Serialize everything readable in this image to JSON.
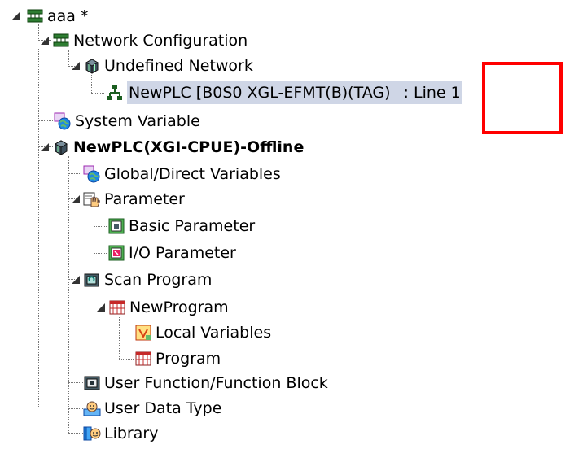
{
  "project": {
    "label": "aaa *",
    "icon": "project-network-icon"
  },
  "network_configuration": {
    "label": "Network Configuration",
    "icon": "network-config-icon"
  },
  "undefined_network": {
    "label": "Undefined Network",
    "icon": "network-cube-icon"
  },
  "newplc_node": {
    "label": "NewPLC [B0S0 XGL-EFMT(B)(TAG)",
    "line_label": ": Line 1",
    "icon": "network-node-icon"
  },
  "system_variable": {
    "label": "System Variable",
    "icon": "globe-variable-icon"
  },
  "plc": {
    "label": "NewPLC(XGI-CPUE)-Offline",
    "icon": "plc-cube-icon"
  },
  "global_direct_variables": {
    "label": "Global/Direct Variables",
    "icon": "globe-variable-icon"
  },
  "parameter": {
    "label": "Parameter",
    "icon": "hand-parameter-icon"
  },
  "basic_parameter": {
    "label": "Basic Parameter",
    "icon": "basic-parameter-icon"
  },
  "io_parameter": {
    "label": "I/O Parameter",
    "icon": "io-parameter-icon"
  },
  "scan_program": {
    "label": "Scan Program",
    "icon": "scan-program-icon"
  },
  "new_program": {
    "label": "NewProgram",
    "icon": "program-grid-icon"
  },
  "local_variables": {
    "label": "Local Variables",
    "icon": "local-variables-icon"
  },
  "program": {
    "label": "Program",
    "icon": "program-grid-icon"
  },
  "user_function_block": {
    "label": "User Function/Function Block",
    "icon": "user-function-icon"
  },
  "user_data_type": {
    "label": "User Data Type",
    "icon": "user-data-type-icon"
  },
  "library": {
    "label": "Library",
    "icon": "library-icon"
  },
  "colors": {
    "selection": "#cfd6e6",
    "highlight_box": "#ff0000",
    "tree_lines": "#777777"
  }
}
